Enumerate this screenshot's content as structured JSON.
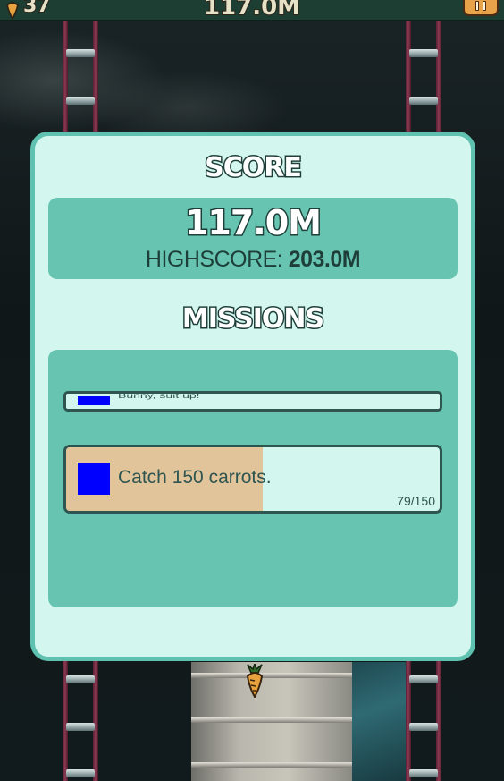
{
  "hud": {
    "carrot_count": "37",
    "distance": "117.0M",
    "pause_icon": "pause-icon"
  },
  "dialog": {
    "score_heading": "SCORE",
    "score_value": "117.0M",
    "highscore_label": "HIGHSCORE:",
    "highscore_value": "203.0M",
    "missions_heading": "MISSIONS",
    "missions": [
      {
        "text": "Bunny, suit up!",
        "icon": "mission-icon"
      },
      {
        "text": "Catch 150 carrots.",
        "icon": "mission-icon",
        "progress_text": "79/150",
        "progress": 0.5267
      }
    ]
  },
  "colors": {
    "dialog_bg": "#d3f7ef",
    "dialog_border": "#5fc2b0",
    "panel_bg": "#67c4b1",
    "progress_fill": "#e1c49a",
    "mission_icon": "#0000ff",
    "hud_bg": "#1d3e33"
  }
}
